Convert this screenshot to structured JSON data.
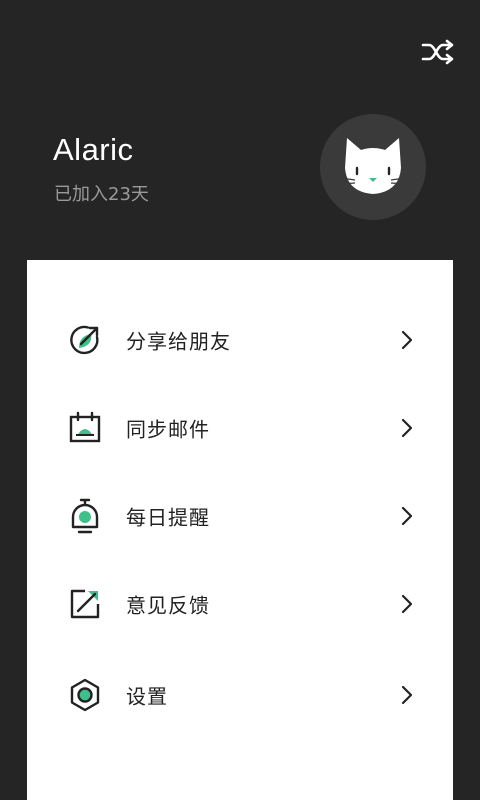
{
  "colors": {
    "header_bg": "#252525",
    "card_bg": "#ffffff",
    "accent": "#3fbf8a",
    "text_primary": "#222222",
    "text_secondary": "#9a9a9a"
  },
  "header": {
    "shuffle_icon": "shuffle-icon"
  },
  "profile": {
    "name": "Alaric",
    "joined": "已加入23天",
    "avatar_icon": "cat-icon"
  },
  "menu": {
    "items": [
      {
        "label": "分享给朋友",
        "icon": "share-icon"
      },
      {
        "label": "同步邮件",
        "icon": "calendar-icon"
      },
      {
        "label": "每日提醒",
        "icon": "bell-icon"
      },
      {
        "label": "意见反馈",
        "icon": "feedback-icon"
      },
      {
        "label": "设置",
        "icon": "settings-icon"
      }
    ]
  }
}
